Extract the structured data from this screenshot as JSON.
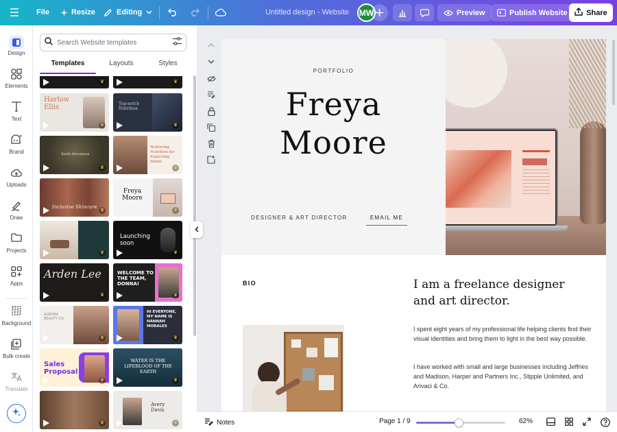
{
  "topbar": {
    "file_label": "File",
    "resize_label": "Resize",
    "editing_label": "Editing",
    "design_title": "Untitled design - Website",
    "avatar_initials": "MW",
    "preview_label": "Preview",
    "publish_label": "Publish Website",
    "share_label": "Share"
  },
  "rail": {
    "items": [
      {
        "label": "Design",
        "icon": "design-icon"
      },
      {
        "label": "Elements",
        "icon": "elements-icon"
      },
      {
        "label": "Text",
        "icon": "text-icon"
      },
      {
        "label": "Brand",
        "icon": "brand-icon"
      },
      {
        "label": "Uploads",
        "icon": "uploads-icon"
      },
      {
        "label": "Draw",
        "icon": "draw-icon"
      },
      {
        "label": "Projects",
        "icon": "projects-icon"
      },
      {
        "label": "Apps",
        "icon": "apps-icon"
      },
      {
        "label": "Background",
        "icon": "background-icon"
      },
      {
        "label": "Bulk create",
        "icon": "bulk-create-icon"
      },
      {
        "label": "Translate",
        "icon": "translate-icon"
      }
    ]
  },
  "panel": {
    "search_placeholder": "Search Website templates",
    "tabs": [
      "Templates",
      "Layouts",
      "Styles"
    ],
    "thumbnails": [
      {
        "text": "",
        "bg": "#1a1a1a"
      },
      {
        "text": "",
        "bg": "#1a1a1a"
      },
      {
        "text": "Harlow Ellis",
        "bg": "#eae6e1"
      },
      {
        "text": "Top-notch Nutrition",
        "bg": "#2a3140"
      },
      {
        "text": "Keith Stevenson",
        "bg": "#3a3628"
      },
      {
        "text": "Nurturing Nutrition for Expecting Moms",
        "bg": "#f6efe7"
      },
      {
        "text": "Inclusive Skincare",
        "bg": "#8a4a3b"
      },
      {
        "text": "Freya Moore",
        "bg": "#f4f4f4"
      },
      {
        "text": "",
        "bg": "#dcd4cc"
      },
      {
        "text": "Launching soon",
        "bg": "#111111"
      },
      {
        "text": "Arden Lee",
        "bg": "#1e1c1a"
      },
      {
        "text": "WELCOME TO THE TEAM, DONNA!",
        "bg": "#1f1f1f"
      },
      {
        "text": "AURORA BEAUTY CO.",
        "bg": "#f2efec"
      },
      {
        "text": "HI EVERYONE, MY NAME IS HANNAH MORALES",
        "bg": "#2b2d3a"
      },
      {
        "text": "Sales Proposal",
        "bg": "#fdf1d8"
      },
      {
        "text": "WATER IS THE LIFEBLOOD OF THE EARTH",
        "bg": "#1c3b4d"
      },
      {
        "text": "",
        "bg": "#7a5a45"
      },
      {
        "text": "Avery Davis",
        "bg": "#ecebe7"
      }
    ]
  },
  "page": {
    "portfolio_label": "PORTFOLIO",
    "name_line1": "Freya",
    "name_line2": "Moore",
    "role": "DESIGNER & ART DIRECTOR",
    "email_link": "EMAIL ME",
    "bio_label": "BIO",
    "bio_heading": "I am a freelance designer and art director.",
    "bio_p1": "I spent eight years of my professional life helping clients find their visual identities and bring them to light in the best way possible.",
    "bio_p2": "I have worked with small and large businesses including Jeffries and Madison, Harper and Partners Inc., Stipple Unlimited, and Arivaci & Co."
  },
  "bottombar": {
    "notes_label": "Notes",
    "page_indicator": "Page 1 / 9",
    "zoom": "62%",
    "zoom_fraction": 0.48
  }
}
